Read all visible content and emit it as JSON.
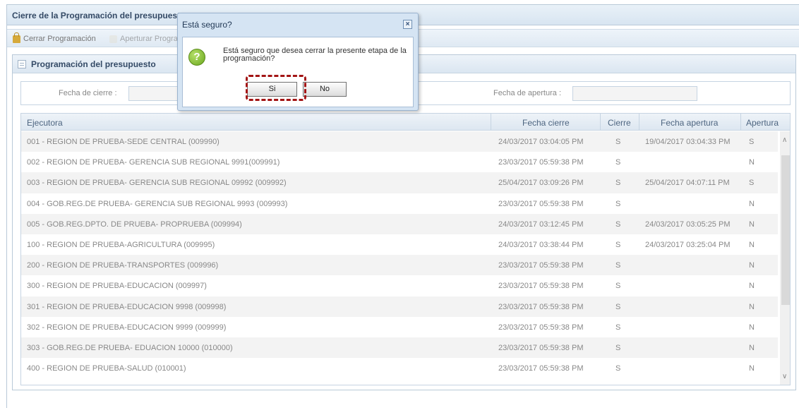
{
  "window": {
    "title": "Cierre de la Programación del presupuesto"
  },
  "toolbar": {
    "close_label": "Cerrar Programación",
    "open_label": "Aperturar Programación"
  },
  "panel": {
    "title": "Programación del presupuesto"
  },
  "filter": {
    "close_date_label": "Fecha de cierre :",
    "open_date_label": "Fecha de apertura :"
  },
  "grid": {
    "columns": [
      "Ejecutora",
      "Fecha cierre",
      "Cierre",
      "Fecha apertura",
      "Apertura"
    ],
    "rows": [
      [
        "001 - REGION DE PRUEBA-SEDE CENTRAL (009990)",
        "24/03/2017 03:04:05 PM",
        "S",
        "19/04/2017 03:04:33 PM",
        "S"
      ],
      [
        "002 - REGION DE PRUEBA- GERENCIA SUB REGIONAL 9991(009991)",
        "23/03/2017 05:59:38 PM",
        "S",
        "",
        "N"
      ],
      [
        "003 - REGION DE PRUEBA- GERENCIA SUB REGIONAL 09992 (009992)",
        "25/04/2017 03:09:26 PM",
        "S",
        "25/04/2017 04:07:11 PM",
        "S"
      ],
      [
        "004 - GOB.REG.DE PRUEBA- GERENCIA SUB REGIONAL 9993 (009993)",
        "23/03/2017 05:59:38 PM",
        "S",
        "",
        "N"
      ],
      [
        "005 - GOB.REG.DPTO. DE PRUEBA- PROPRUEBA (009994)",
        "24/03/2017 03:12:45 PM",
        "S",
        "24/03/2017 03:05:25 PM",
        "N"
      ],
      [
        "100 - REGION DE PRUEBA-AGRICULTURA (009995)",
        "24/03/2017 03:38:44 PM",
        "S",
        "24/03/2017 03:25:04 PM",
        "N"
      ],
      [
        "200 - REGION DE PRUEBA-TRANSPORTES (009996)",
        "23/03/2017 05:59:38 PM",
        "S",
        "",
        "N"
      ],
      [
        "300 - REGION DE PRUEBA-EDUCACION (009997)",
        "23/03/2017 05:59:38 PM",
        "S",
        "",
        "N"
      ],
      [
        "301 - REGION DE PRUEBA-EDUCACION 9998 (009998)",
        "23/03/2017 05:59:38 PM",
        "S",
        "",
        "N"
      ],
      [
        "302 - REGION DE PRUEBA-EDUCACION 9999 (009999)",
        "23/03/2017 05:59:38 PM",
        "S",
        "",
        "N"
      ],
      [
        "303 - GOB.REG.DE PRUEBA- EDUACION 10000 (010000)",
        "23/03/2017 05:59:38 PM",
        "S",
        "",
        "N"
      ],
      [
        "400 - REGION DE PRUEBA-SALUD (010001)",
        "23/03/2017 05:59:38 PM",
        "S",
        "",
        "N"
      ]
    ]
  },
  "dialog": {
    "title": "Está seguro?",
    "close_glyph": "×",
    "icon_glyph": "?",
    "message": "Está seguro que desea cerrar la presente etapa de la programación?",
    "yes_label": "Si",
    "no_label": "No"
  },
  "icons": {
    "toolbar_close": "lock-icon",
    "toolbar_open": "unlock-icon",
    "panel": "panel-icon",
    "dialog": "question-icon",
    "scroll_up": "chevron-up-icon",
    "scroll_down": "chevron-down-icon"
  },
  "colors": {
    "highlight": "#a31515",
    "header_text": "#344a66",
    "dialog_bg": "#d5e4f3"
  }
}
